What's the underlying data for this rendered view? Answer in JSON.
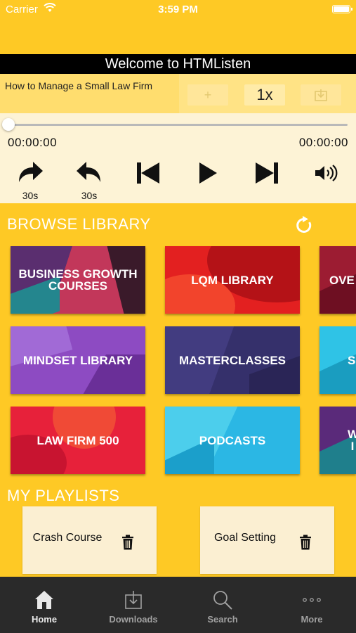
{
  "status": {
    "carrier": "Carrier",
    "time": "3:59 PM"
  },
  "header": {
    "title": "Welcome to HTMListen"
  },
  "now_playing": {
    "title": "How to Manage a Small Law Firm",
    "add_label": "+",
    "speed_label": "1x",
    "progress": 0
  },
  "player": {
    "elapsed": "00:00:00",
    "duration": "00:00:00",
    "skip_forward_label": "30s",
    "skip_back_label": "30s"
  },
  "browse": {
    "title": "BROWSE LIBRARY",
    "cards": [
      {
        "label": "BUSINESS GROWTH COURSES"
      },
      {
        "label": "LQM LIBRARY"
      },
      {
        "label": "OVE"
      },
      {
        "label": "MINDSET LIBRARY"
      },
      {
        "label": "MASTERCLASSES"
      },
      {
        "label": "S"
      },
      {
        "label": "LAW FIRM 500"
      },
      {
        "label": "PODCASTS"
      },
      {
        "label": "W I"
      }
    ]
  },
  "playlists": {
    "title": "MY PLAYLISTS",
    "items": [
      {
        "name": "Crash Course"
      },
      {
        "name": "Goal Setting"
      }
    ]
  },
  "tabbar": {
    "items": [
      {
        "label": "Home",
        "icon": "home-icon",
        "active": true
      },
      {
        "label": "Downloads",
        "icon": "download-icon"
      },
      {
        "label": "Search",
        "icon": "search-icon"
      },
      {
        "label": "More",
        "icon": "more-icon"
      }
    ]
  },
  "colors": {
    "background": "#FEC925",
    "title_bar": "#000000",
    "player_bg": "#FDF3D6",
    "tab_bar": "#2A2A2A"
  }
}
